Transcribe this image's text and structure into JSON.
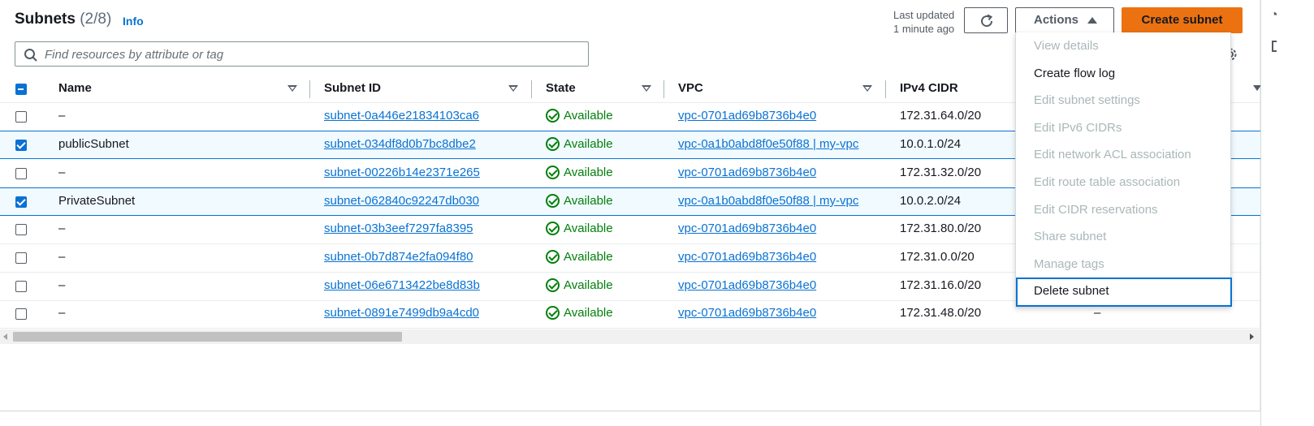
{
  "header": {
    "title": "Subnets",
    "count": "(2/8)",
    "info_label": "Info",
    "last_updated_line1": "Last updated",
    "last_updated_line2": "1 minute ago",
    "actions_label": "Actions",
    "create_label": "Create subnet"
  },
  "search": {
    "placeholder": "Find resources by attribute or tag"
  },
  "columns": {
    "name": "Name",
    "subnet_id": "Subnet ID",
    "state": "State",
    "vpc": "VPC",
    "ipv4": "IPv4 CIDR"
  },
  "rows": [
    {
      "name": "–",
      "subnet_id": "subnet-0a446e21834103ca6",
      "state": "Available",
      "vpc": "vpc-0701ad69b8736b4e0",
      "ipv4": "172.31.64.0/20",
      "selected": false
    },
    {
      "name": "publicSubnet",
      "subnet_id": "subnet-034df8d0b7bc8dbe2",
      "state": "Available",
      "vpc": "vpc-0a1b0abd8f0e50f88 | my-vpc",
      "ipv4": "10.0.1.0/24",
      "selected": true
    },
    {
      "name": "–",
      "subnet_id": "subnet-00226b14e2371e265",
      "state": "Available",
      "vpc": "vpc-0701ad69b8736b4e0",
      "ipv4": "172.31.32.0/20",
      "selected": false
    },
    {
      "name": "PrivateSubnet",
      "subnet_id": "subnet-062840c92247db030",
      "state": "Available",
      "vpc": "vpc-0a1b0abd8f0e50f88 | my-vpc",
      "ipv4": "10.0.2.0/24",
      "selected": true
    },
    {
      "name": "–",
      "subnet_id": "subnet-03b3eef7297fa8395",
      "state": "Available",
      "vpc": "vpc-0701ad69b8736b4e0",
      "ipv4": "172.31.80.0/20",
      "selected": false
    },
    {
      "name": "–",
      "subnet_id": "subnet-0b7d874e2fa094f80",
      "state": "Available",
      "vpc": "vpc-0701ad69b8736b4e0",
      "ipv4": "172.31.0.0/20",
      "selected": false
    },
    {
      "name": "–",
      "subnet_id": "subnet-06e6713422be8d83b",
      "state": "Available",
      "vpc": "vpc-0701ad69b8736b4e0",
      "ipv4": "172.31.16.0/20",
      "selected": false
    },
    {
      "name": "–",
      "subnet_id": "subnet-0891e7499db9a4cd0",
      "state": "Available",
      "vpc": "vpc-0701ad69b8736b4e0",
      "ipv4": "172.31.48.0/20",
      "selected": false
    }
  ],
  "last_row_extra": "–",
  "actions_menu": [
    {
      "label": "View details",
      "enabled": false
    },
    {
      "label": "Create flow log",
      "enabled": true
    },
    {
      "label": "Edit subnet settings",
      "enabled": false
    },
    {
      "label": "Edit IPv6 CIDRs",
      "enabled": false
    },
    {
      "label": "Edit network ACL association",
      "enabled": false
    },
    {
      "label": "Edit route table association",
      "enabled": false
    },
    {
      "label": "Edit CIDR reservations",
      "enabled": false
    },
    {
      "label": "Share subnet",
      "enabled": false
    },
    {
      "label": "Manage tags",
      "enabled": false
    },
    {
      "label": "Delete subnet",
      "enabled": true,
      "focused": true
    }
  ],
  "colors": {
    "accent": "#0972d3",
    "primary_button": "#ec7211",
    "status_ok": "#037f0c"
  }
}
